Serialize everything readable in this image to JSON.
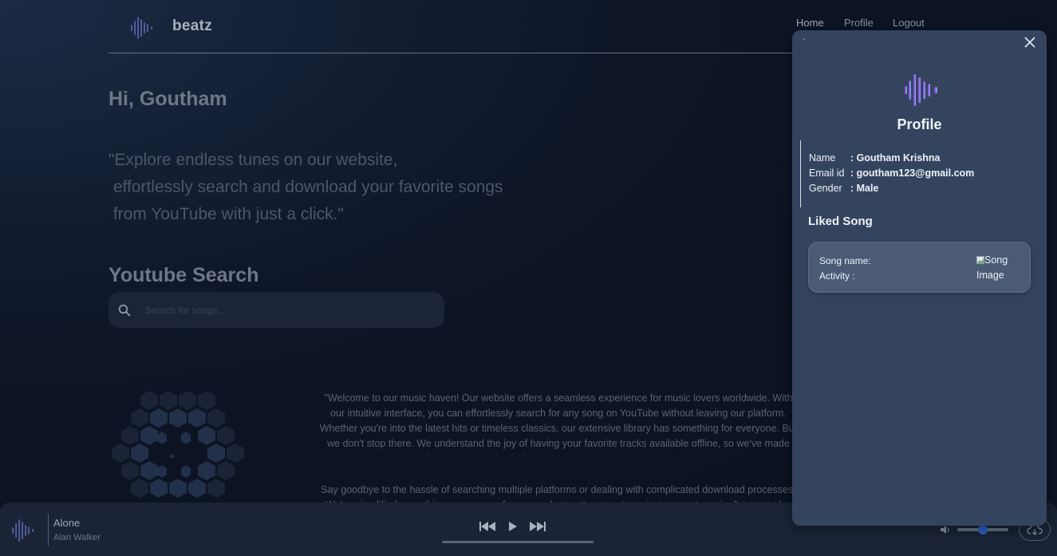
{
  "header": {
    "brand": "beatz",
    "nav": [
      {
        "label": "Home"
      },
      {
        "label": "Profile"
      },
      {
        "label": "Logout"
      }
    ]
  },
  "main": {
    "greeting": "Hi, Goutham",
    "tagline": "\"Explore endless tunes on our website,\n effortlessly search and download your favorite songs\n from YouTube with just a click.\"",
    "youtube_title": "Youtube Search",
    "search": {
      "placeholder": "Search for songs...",
      "value": ""
    },
    "about_1": "\"Welcome to our music haven! Our website offers a seamless experience for music lovers worldwide. With our intuitive interface, you can effortlessly search for any song on YouTube without leaving our platform. Whether you're into the latest hits or timeless classics, our extensive library has something for everyone. But we don't stop there. We understand the joy of having your favorite tracks available offline, so we've made downloading a breeze. Simply find your desired song, hit the download button.",
    "about_2": "Say goodbye to the hassle of searching multiple platforms or dealing with complicated download processes. We've simplified everything, so you can focus on what matters most – enjoying great music. Join us today and experience"
  },
  "player": {
    "song_title": "Alone",
    "artist": "Alan Walker",
    "progress": 0.0,
    "volume": 0.5
  },
  "profile_panel": {
    "tick": "`",
    "title": "Profile",
    "fields": [
      {
        "label": "Name",
        "value": ": Goutham Krishna"
      },
      {
        "label": "Email id",
        "value": ": goutham123@gmail.com"
      },
      {
        "label": "Gender",
        "value": ": Male"
      }
    ],
    "liked_title": "Liked Song",
    "liked_song": {
      "name_label": "Song name:",
      "activity_label": "Activity :",
      "image_alt": "Song Image"
    }
  },
  "colors": {
    "accent_purple": "#7b4fd6",
    "accent_cyan": "#5ec8f0",
    "panel_bg": "#34445f",
    "player_bg": "#1a2436"
  },
  "icons": [
    "logo-wave-icon",
    "search-icon",
    "previous-icon",
    "play-icon",
    "next-icon",
    "volume-icon",
    "cloud-download-icon",
    "close-icon",
    "broken-image-icon"
  ]
}
